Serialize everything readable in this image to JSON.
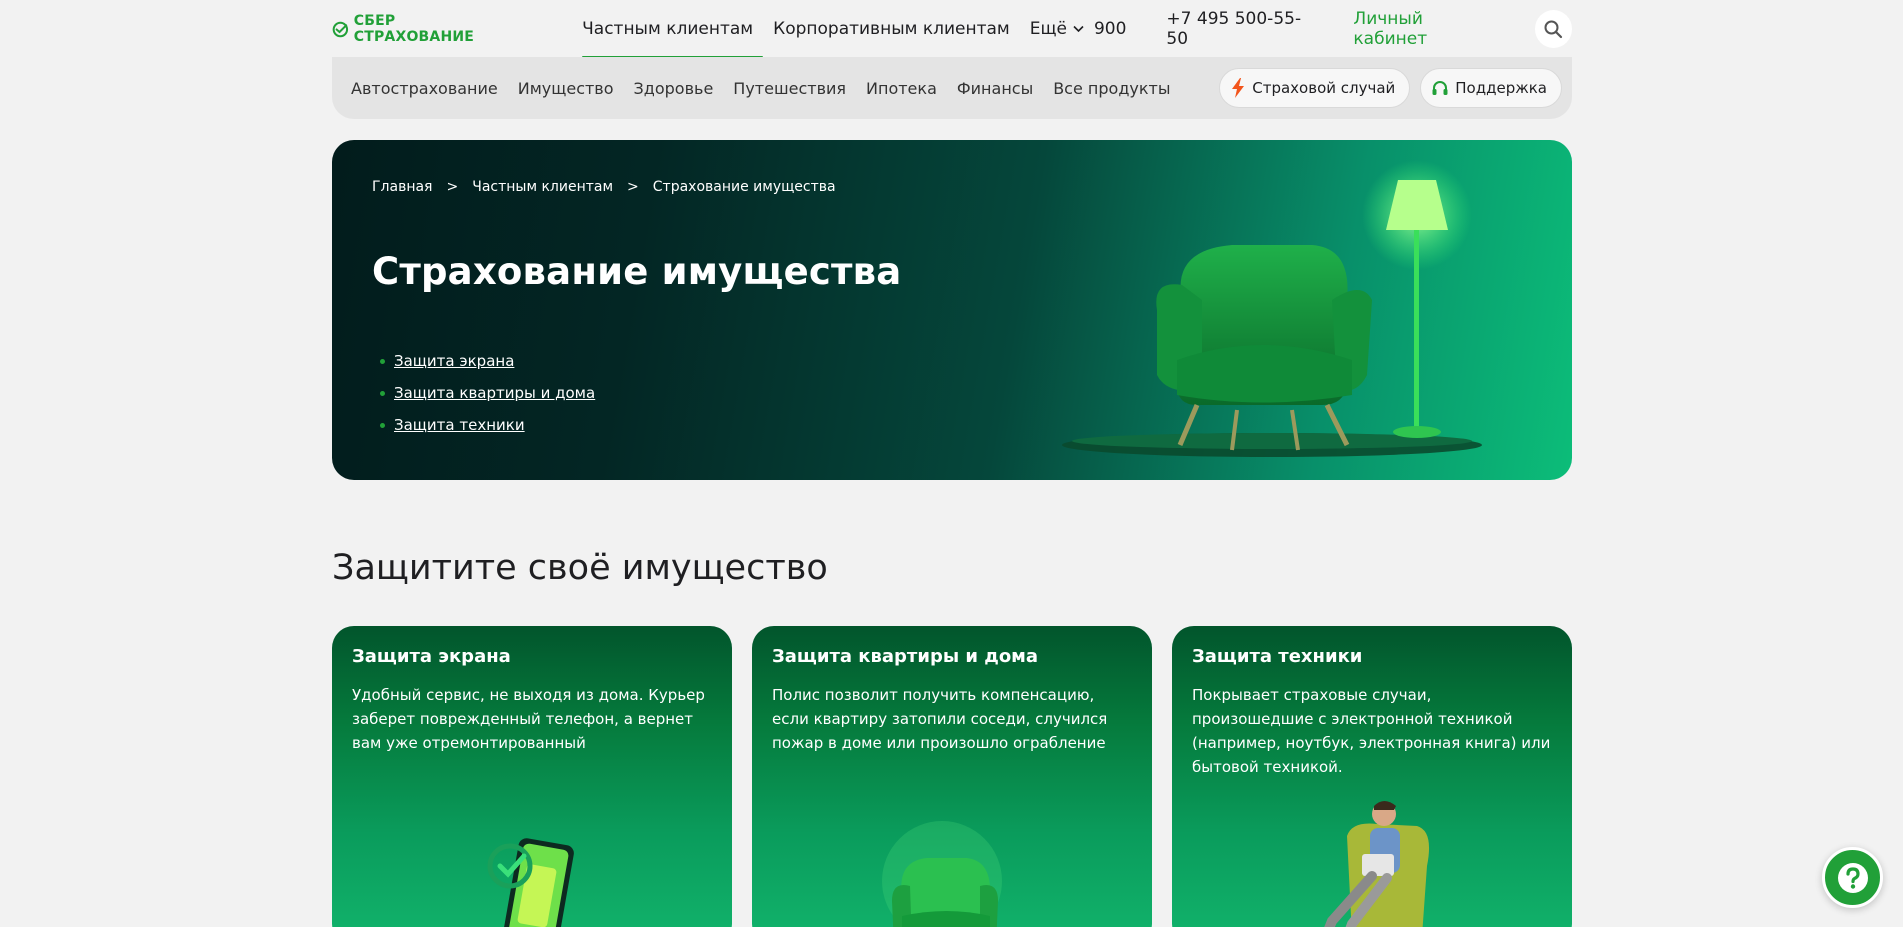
{
  "header": {
    "logo_text": "СБЕР СТРАХОВАНИЕ",
    "nav": [
      {
        "label": "Частным клиентам",
        "active": true
      },
      {
        "label": "Корпоративным клиентам",
        "active": false
      },
      {
        "label": "Ещё",
        "active": false
      }
    ],
    "phone_short": "900",
    "phone_long": "+7 495 500-55-50",
    "cabinet": "Личный кабинет"
  },
  "subnav": {
    "items": [
      "Автострахование",
      "Имущество",
      "Здоровье",
      "Путешествия",
      "Ипотека",
      "Финансы",
      "Все продукты"
    ],
    "insurance_case": "Страховой случай",
    "support": "Поддержка"
  },
  "hero": {
    "breadcrumb": [
      "Главная",
      "Частным клиентам",
      "Страхование имущества"
    ],
    "breadcrumb_sep": ">",
    "title": "Страхование имущества",
    "links": [
      "Защита экрана",
      "Защита квартиры и дома",
      "Защита техники"
    ]
  },
  "section": {
    "title": "Защитите своё имущество",
    "cards": [
      {
        "title": "Защита экрана",
        "text": "Удобный сервис, не выходя из дома. Курьер заберет поврежденный телефон, а вернет вам уже отремонтированный"
      },
      {
        "title": "Защита квартиры и дома",
        "text": "Полис позволит получить компенсацию, если квартиру затопили соседи, случился пожар в доме или произошло ограбление"
      },
      {
        "title": "Защита техники",
        "text": "Покрывает страховые случаи, произошедшие с электронной техникой (например, ноутбук, электронная книга) или бытовой техникой."
      }
    ]
  },
  "colors": {
    "brand": "#21a038",
    "background": "#f2f2f2"
  },
  "icons": {
    "logo": "sber-check-icon",
    "chevron": "chevron-down-icon",
    "search": "search-icon",
    "lightning": "lightning-icon",
    "headset": "headset-icon",
    "help": "question-icon"
  }
}
